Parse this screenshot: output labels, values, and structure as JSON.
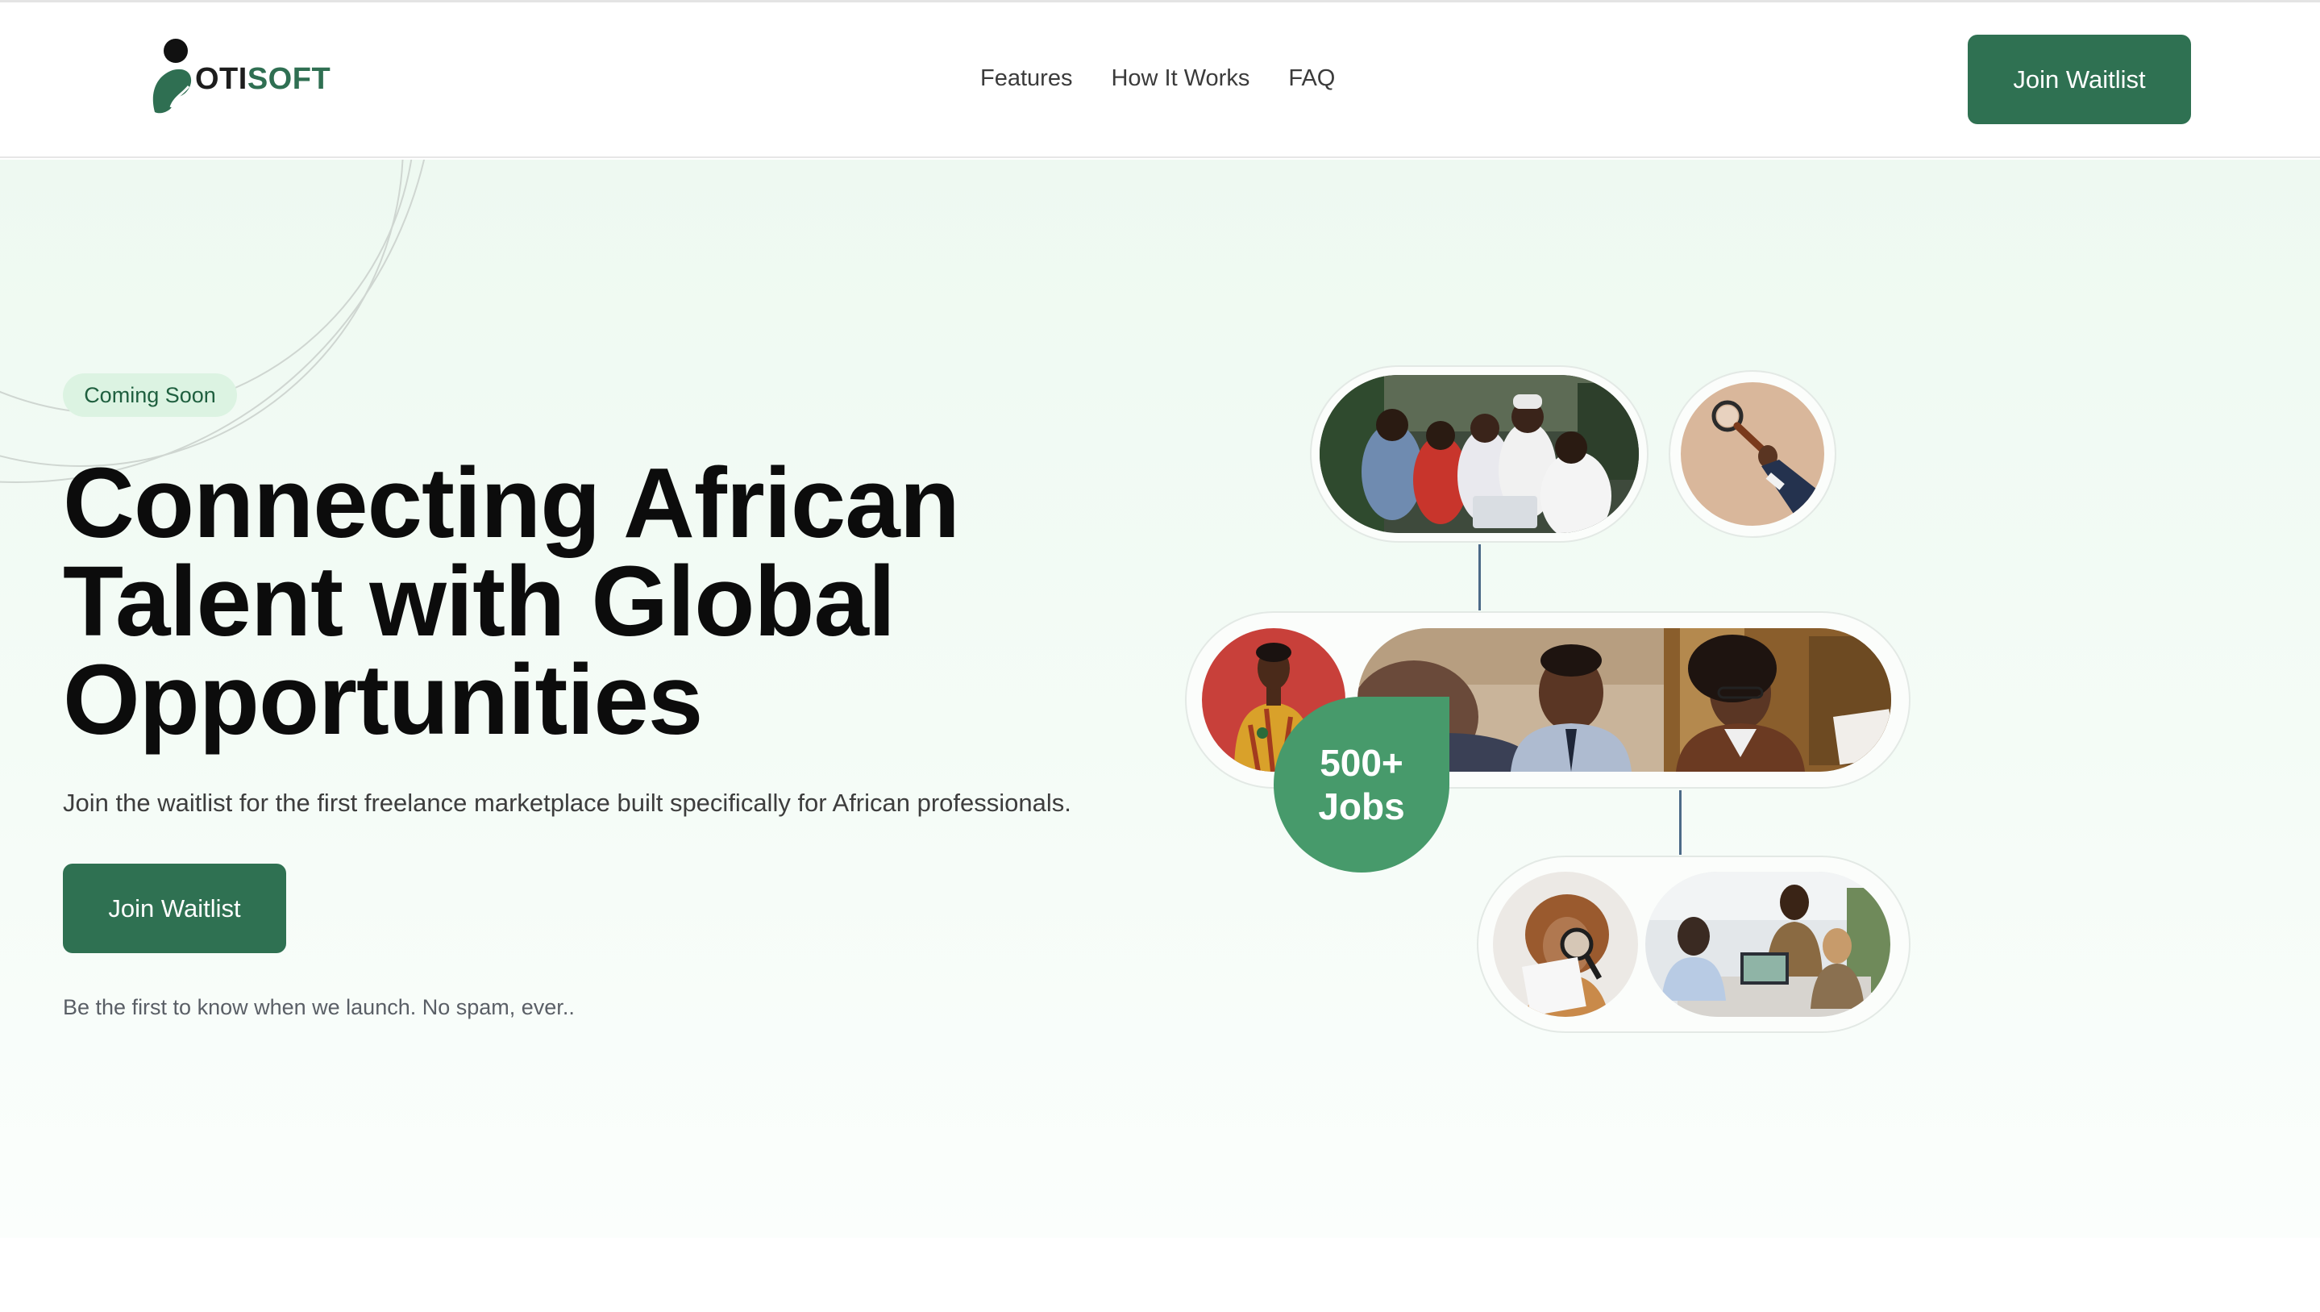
{
  "brand": {
    "name_dark": "OTI",
    "name_accent": "SOFT",
    "dark_color": "#1d1d1d",
    "accent_color": "#2f6f52"
  },
  "nav": {
    "items": [
      {
        "label": "Features"
      },
      {
        "label": "How It Works"
      },
      {
        "label": "FAQ"
      }
    ]
  },
  "header": {
    "cta_label": "Join Waitlist"
  },
  "hero": {
    "badge": "Coming Soon",
    "headline_line1": "Connecting African",
    "headline_line2": "Talent with Global",
    "headline_line3": "Opportunities",
    "subheadline": "Join the waitlist for the first freelance marketplace built specifically for African professionals.",
    "cta_label": "Join Waitlist",
    "note": "Be the first to know when we launch. No spam, ever.."
  },
  "collage": {
    "stat_line1": "500+",
    "stat_line2": "Jobs"
  },
  "colors": {
    "primary_button": "#2f7152",
    "stat_badge": "#479a6b",
    "hero_background": "#eef9f1",
    "badge_background": "#dcf3e2"
  },
  "icons": {
    "logo": "otisoft-person-leaf-logo"
  }
}
